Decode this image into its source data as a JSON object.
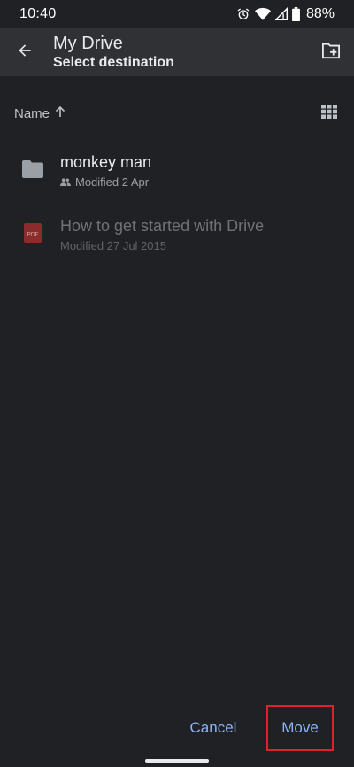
{
  "status_bar": {
    "time": "10:40",
    "battery": "88%",
    "icons": [
      "alarm-icon",
      "wifi-icon",
      "signal-icon",
      "battery-icon"
    ]
  },
  "app_bar": {
    "title": "My Drive",
    "subtitle": "Select destination",
    "back_icon": "arrow-back-icon",
    "new_folder_icon": "new-folder-icon"
  },
  "sort": {
    "label": "Name",
    "direction_icon": "arrow-up-icon",
    "view_icon": "grid-view-icon"
  },
  "files": [
    {
      "name": "monkey man",
      "meta": "Modified 2 Apr",
      "icon": "folder-icon",
      "shared": true,
      "enabled": true
    },
    {
      "name": "How to get started with Drive",
      "meta": "Modified 27 Jul 2015",
      "icon": "pdf-icon",
      "pdf_label": "PDF",
      "shared": false,
      "enabled": false
    }
  ],
  "actions": {
    "cancel": "Cancel",
    "move": "Move"
  },
  "colors": {
    "background": "#202124",
    "app_bar": "#303134",
    "accent": "#8ab4f8",
    "highlight_box": "#e0202a",
    "pdf": "#8c2b2b"
  }
}
